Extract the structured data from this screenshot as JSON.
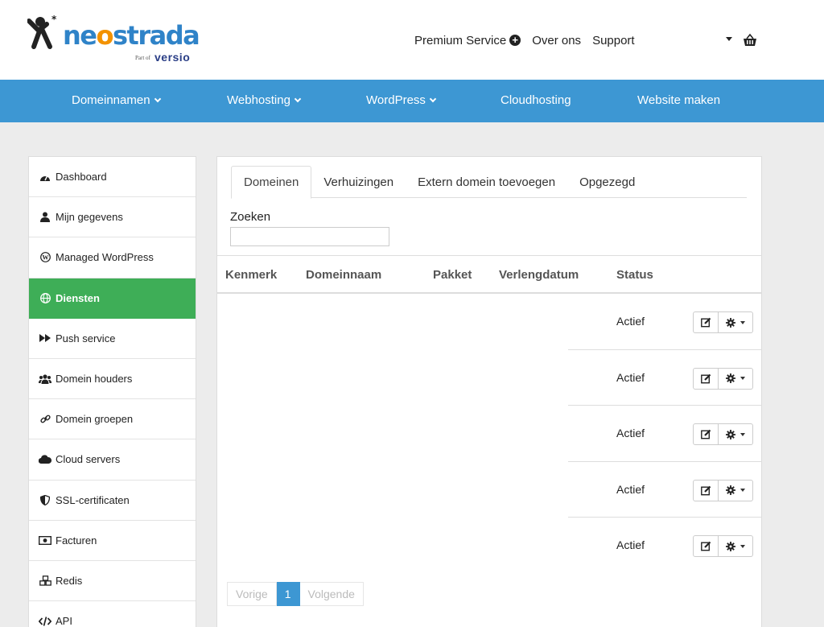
{
  "header": {
    "logo": {
      "brand": "neostrada",
      "part_of": "Part of",
      "parent_brand": "versio"
    },
    "topnav": {
      "premium": "Premium Service",
      "about": "Over ons",
      "support": "Support"
    }
  },
  "menubar": {
    "items": [
      {
        "label": "Domeinnamen",
        "has_dropdown": true
      },
      {
        "label": "Webhosting",
        "has_dropdown": true
      },
      {
        "label": "WordPress",
        "has_dropdown": true
      },
      {
        "label": "Cloudhosting",
        "has_dropdown": false
      },
      {
        "label": "Website maken",
        "has_dropdown": false
      }
    ]
  },
  "sidebar": {
    "items": [
      {
        "label": "Dashboard",
        "icon": "dashboard-icon"
      },
      {
        "label": "Mijn gegevens",
        "icon": "user-icon"
      },
      {
        "label": "Managed WordPress",
        "icon": "wordpress-icon"
      },
      {
        "label": "Diensten",
        "icon": "globe-icon",
        "active": true
      },
      {
        "label": "Push service",
        "icon": "fast-forward-icon"
      },
      {
        "label": "Domein houders",
        "icon": "users-icon"
      },
      {
        "label": "Domein groepen",
        "icon": "link-icon"
      },
      {
        "label": "Cloud servers",
        "icon": "cloud-icon"
      },
      {
        "label": "SSL-certificaten",
        "icon": "shield-icon"
      },
      {
        "label": "Facturen",
        "icon": "money-bill-icon"
      },
      {
        "label": "Redis",
        "icon": "cubes-icon"
      },
      {
        "label": "API",
        "icon": "code-icon"
      }
    ]
  },
  "main": {
    "tabs": [
      {
        "label": "Domeinen",
        "active": true
      },
      {
        "label": "Verhuizingen"
      },
      {
        "label": "Extern domein toevoegen"
      },
      {
        "label": "Opgezegd"
      }
    ],
    "search": {
      "label": "Zoeken",
      "value": ""
    },
    "table": {
      "columns": [
        "Kenmerk",
        "Domeinnaam",
        "Pakket",
        "Verlengdatum",
        "Status"
      ],
      "rows": [
        {
          "status": "Actief"
        },
        {
          "status": "Actief"
        },
        {
          "status": "Actief"
        },
        {
          "status": "Actief"
        },
        {
          "status": "Actief"
        }
      ]
    },
    "pagination": {
      "prev": "Vorige",
      "current": "1",
      "next": "Volgende"
    }
  },
  "colors": {
    "menubar": "#3d97d3",
    "active_sidebar": "#3eae57",
    "brand_blue": "#2f83c8",
    "brand_orange": "#f39200"
  }
}
